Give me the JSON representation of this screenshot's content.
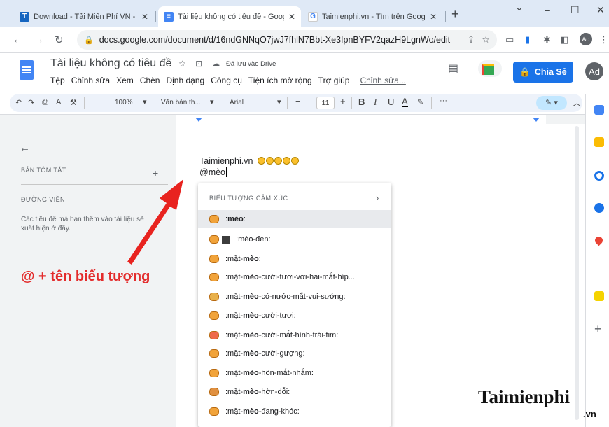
{
  "tabs": [
    {
      "label": "Download - Tải Miễn Phí VN - Ph"
    },
    {
      "label": "Tài liệu không có tiêu đề - Googl"
    },
    {
      "label": "Taimienphi.vn - Tìm trên Google"
    }
  ],
  "window": {
    "minimize": "–",
    "maximize": "☐",
    "close": "✕",
    "dropdown": "⌄"
  },
  "new_tab": "+",
  "address": {
    "url": "docs.google.com/document/d/16ndGNNqO7jwJ7fhlN7Bbt-Xe3IpnBYFV2qazH9LgnWo/edit"
  },
  "profile_initials": "Ad",
  "doc": {
    "title": "Tài liệu không có tiêu đề",
    "saved": "Đã lưu vào Drive",
    "menu": [
      "Tệp",
      "Chỉnh sửa",
      "Xem",
      "Chèn",
      "Định dạng",
      "Công cụ",
      "Tiện ích mở rộng",
      "Trợ giúp"
    ],
    "menu_last": "Chỉnh sửa...",
    "share_label": "Chia Sẻ",
    "user_initials": "Ad"
  },
  "toolbar": {
    "zoom": "100%",
    "style": "Văn bản th...",
    "font": "Arial",
    "size": "11",
    "more": "···"
  },
  "outline": {
    "summary_heading": "BẢN TÓM TẮT",
    "outline_heading": "ĐƯỜNG VIỀN",
    "description": "Các tiêu đề mà bạn thêm vào tài liệu sẽ xuất hiện ở đây."
  },
  "content": {
    "line1": "Taimienphi.vn",
    "line2": "@mèo"
  },
  "annotation": "@ + tên biểu tượng",
  "emoji_popup": {
    "heading": "BIỂU TƯỢNG CẢM XÚC",
    "items": [
      {
        "prefix": ":",
        "bold": "mèo",
        "suffix": ":"
      },
      {
        "prefix": ":",
        "bold": "mèo",
        "suffix": "-đen:"
      },
      {
        "prefix": ":mặt-",
        "bold": "mèo",
        "suffix": ":"
      },
      {
        "prefix": ":mặt-",
        "bold": "mèo",
        "suffix": "-cười-tươi-với-hai-mắt-híp..."
      },
      {
        "prefix": ":mặt-",
        "bold": "mèo",
        "suffix": "-có-nước-mắt-vui-sướng:"
      },
      {
        "prefix": ":mặt-",
        "bold": "mèo",
        "suffix": "-cười-tươi:"
      },
      {
        "prefix": ":mặt-",
        "bold": "mèo",
        "suffix": "-cười-mắt-hình-trái-tim:"
      },
      {
        "prefix": ":mặt-",
        "bold": "mèo",
        "suffix": "-cười-gượng:"
      },
      {
        "prefix": ":mặt-",
        "bold": "mèo",
        "suffix": "-hôn-mắt-nhắm:"
      },
      {
        "prefix": ":mặt-",
        "bold": "mèo",
        "suffix": "-hờn-dỗi:"
      },
      {
        "prefix": ":mặt-",
        "bold": "mèo",
        "suffix": "-đang-khóc:"
      }
    ]
  },
  "watermark": {
    "main": "Taimienphi",
    "sub": ".vn"
  },
  "colors": {
    "accent": "#1a73e8",
    "annotation": "#e32b2b",
    "arrow": "#e8231f"
  }
}
